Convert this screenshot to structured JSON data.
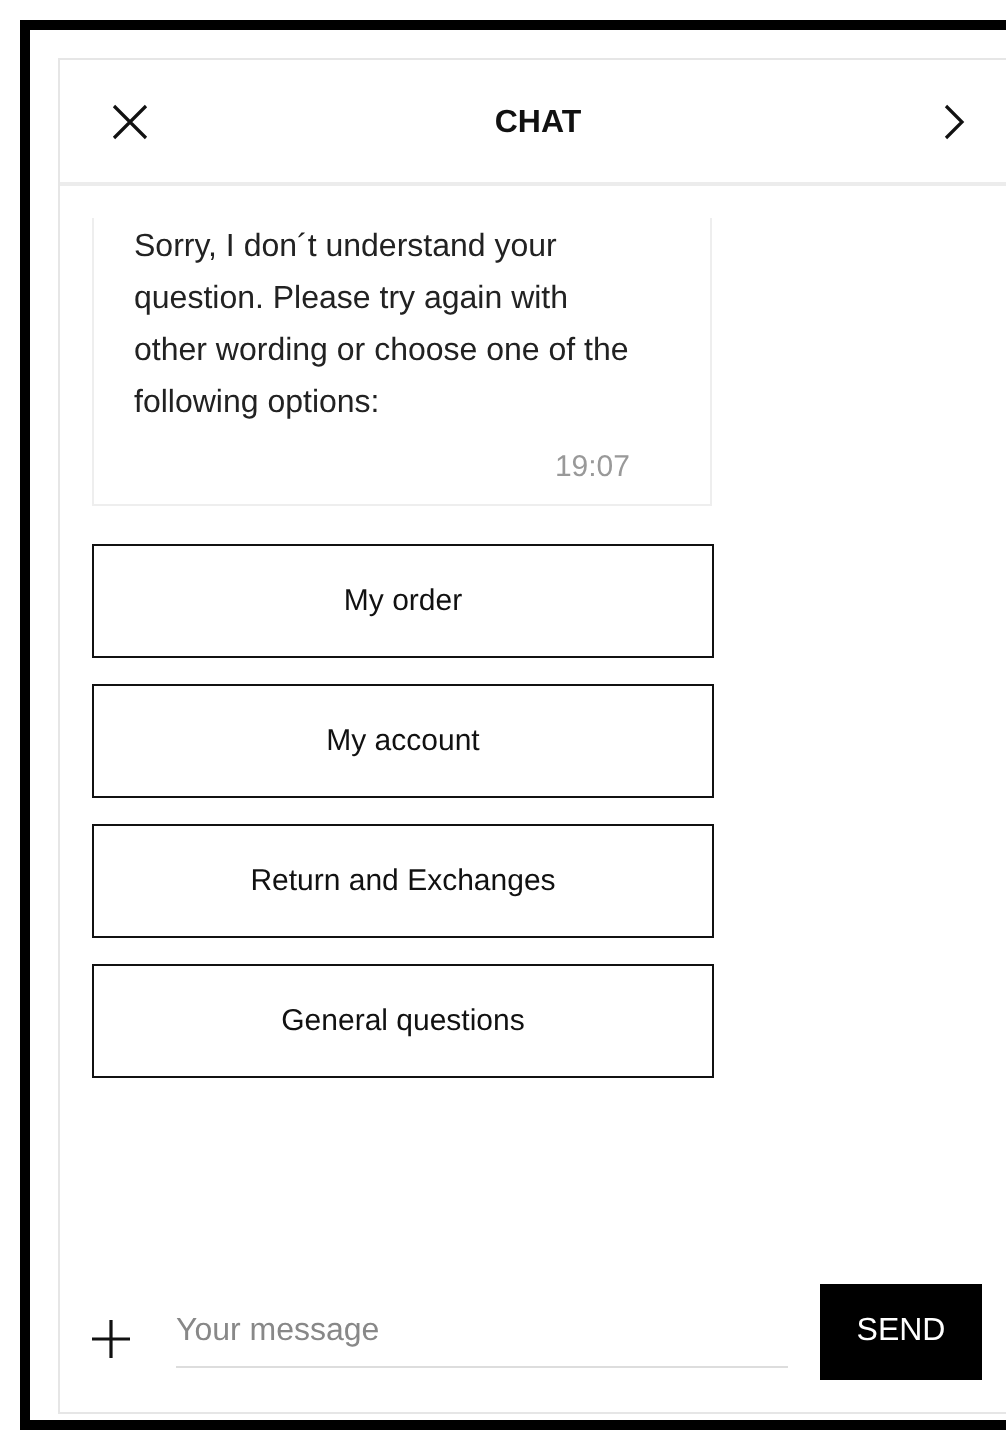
{
  "header": {
    "title": "CHAT"
  },
  "message": {
    "text": "Sorry, I don´t understand your question. Please try again with other wording or choose one of the following options:",
    "time": "19:07"
  },
  "options": [
    {
      "label": "My order"
    },
    {
      "label": "My account"
    },
    {
      "label": "Return and Exchanges"
    },
    {
      "label": "General questions"
    }
  ],
  "composer": {
    "placeholder": "Your message",
    "send": "SEND"
  }
}
